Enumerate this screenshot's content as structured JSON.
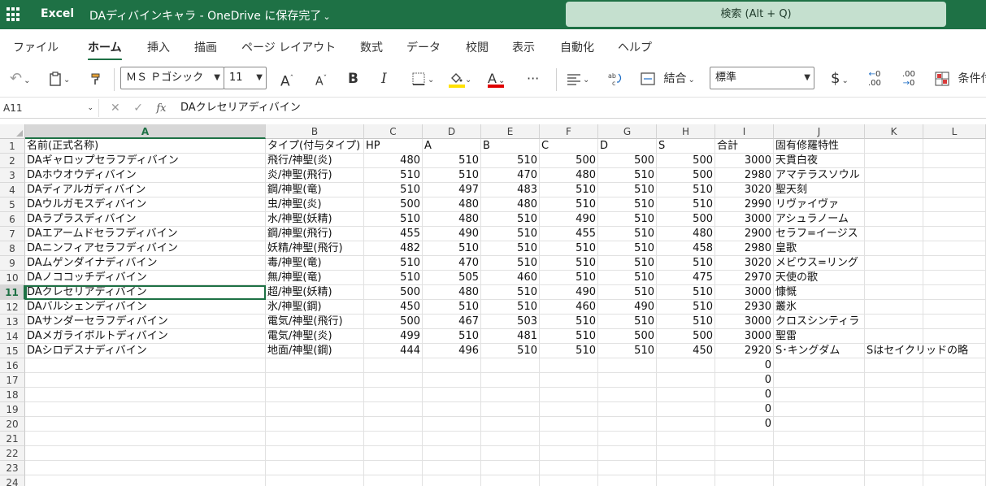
{
  "app": {
    "name": "Excel",
    "doc_title": "DAディバインキャラ - OneDrive に保存完了",
    "search_placeholder": "検索 (Alt + Q)"
  },
  "menu": {
    "tabs": [
      "ファイル",
      "ホーム",
      "挿入",
      "描画",
      "ページ レイアウト",
      "数式",
      "データ",
      "校閲",
      "表示",
      "自動化",
      "ヘルプ"
    ],
    "active": "ホーム"
  },
  "ribbon": {
    "font_name": "ＭＳ Ｐゴシック",
    "font_size": "11",
    "merge_label": "結合",
    "number_format": "標準",
    "currency_symbol": "$",
    "conditional_label": "条件付",
    "bold_glyph": "B",
    "italic_glyph": "I",
    "font_color_glyph": "A",
    "grow_font_glyph": "A",
    "shrink_font_glyph": "A",
    "more_glyph": "···",
    "underline_color": "#ffe100",
    "font_color": "#e00000",
    "inc_decimal_label": ".00",
    "dec_decimal_label": ".00"
  },
  "formula_bar": {
    "name_box": "A11",
    "fx_label": "fx",
    "content": "DAクレセリアディバイン"
  },
  "sheet": {
    "columns": [
      "A",
      "B",
      "C",
      "D",
      "E",
      "F",
      "G",
      "H",
      "I",
      "J",
      "K",
      "L"
    ],
    "row_numbers": [
      "1",
      "2",
      "3",
      "4",
      "5",
      "6",
      "7",
      "8",
      "9",
      "10",
      "11",
      "12",
      "13",
      "14",
      "15",
      "16",
      "17",
      "18",
      "19",
      "20",
      "21",
      "22",
      "23",
      "24"
    ],
    "selected_cell": "A11",
    "rows": [
      [
        "名前(正式名称)",
        "タイプ(付与タイプ)",
        "HP",
        "A",
        "B",
        "C",
        "D",
        "S",
        "合計",
        "固有修羅特性",
        "",
        ""
      ],
      [
        "DAギャロップセラフディバイン",
        "飛行/神聖(炎)",
        "480",
        "510",
        "510",
        "500",
        "500",
        "500",
        "3000",
        "天貫白夜",
        "",
        ""
      ],
      [
        "DAホウオウディバイン",
        "炎/神聖(飛行)",
        "510",
        "510",
        "470",
        "480",
        "510",
        "500",
        "2980",
        "アマテラスソウル",
        "",
        ""
      ],
      [
        "DAディアルガディバイン",
        "鋼/神聖(竜)",
        "510",
        "497",
        "483",
        "510",
        "510",
        "510",
        "3020",
        "聖天刻",
        "",
        ""
      ],
      [
        "DAウルガモスディバイン",
        "虫/神聖(炎)",
        "500",
        "480",
        "480",
        "510",
        "510",
        "510",
        "2990",
        "リヴァイヴァ",
        "",
        ""
      ],
      [
        "DAラプラスディバイン",
        "水/神聖(妖精)",
        "510",
        "480",
        "510",
        "490",
        "510",
        "500",
        "3000",
        "アシュラノーム",
        "",
        ""
      ],
      [
        "DAエアームドセラフディバイン",
        "鋼/神聖(飛行)",
        "455",
        "490",
        "510",
        "455",
        "510",
        "480",
        "2900",
        "セラフ=イージス",
        "",
        ""
      ],
      [
        "DAニンフィアセラフディバイン",
        "妖精/神聖(飛行)",
        "482",
        "510",
        "510",
        "510",
        "510",
        "458",
        "2980",
        "皇歌",
        "",
        ""
      ],
      [
        "DAムゲンダイナディバイン",
        "毒/神聖(竜)",
        "510",
        "470",
        "510",
        "510",
        "510",
        "510",
        "3020",
        "メビウス=リング",
        "",
        ""
      ],
      [
        "DAノココッチディバイン",
        "無/神聖(竜)",
        "510",
        "505",
        "460",
        "510",
        "510",
        "475",
        "2970",
        "天使の歌",
        "",
        ""
      ],
      [
        "DAクレセリアディバイン",
        "超/神聖(妖精)",
        "500",
        "480",
        "510",
        "490",
        "510",
        "510",
        "3000",
        "慷慨",
        "",
        ""
      ],
      [
        "DAバルシェンディバイン",
        "氷/神聖(鋼)",
        "450",
        "510",
        "510",
        "460",
        "490",
        "510",
        "2930",
        "叢氷",
        "",
        ""
      ],
      [
        "DAサンダーセラフディバイン",
        "電気/神聖(飛行)",
        "500",
        "467",
        "503",
        "510",
        "510",
        "510",
        "3000",
        "クロスシンティラ",
        "",
        ""
      ],
      [
        "DAメガライボルトディバイン",
        "電気/神聖(炎)",
        "499",
        "510",
        "481",
        "510",
        "500",
        "500",
        "3000",
        "聖雷",
        "",
        ""
      ],
      [
        "DAシロデスナディバイン",
        "地面/神聖(鋼)",
        "444",
        "496",
        "510",
        "510",
        "510",
        "450",
        "2920",
        "S･キングダム",
        "Sはセイクリッドの略",
        ""
      ],
      [
        "",
        "",
        "",
        "",
        "",
        "",
        "",
        "",
        "0",
        "",
        "",
        ""
      ],
      [
        "",
        "",
        "",
        "",
        "",
        "",
        "",
        "",
        "0",
        "",
        "",
        ""
      ],
      [
        "",
        "",
        "",
        "",
        "",
        "",
        "",
        "",
        "0",
        "",
        "",
        ""
      ],
      [
        "",
        "",
        "",
        "",
        "",
        "",
        "",
        "",
        "0",
        "",
        "",
        ""
      ],
      [
        "",
        "",
        "",
        "",
        "",
        "",
        "",
        "",
        "0",
        "",
        "",
        ""
      ],
      [
        "",
        "",
        "",
        "",
        "",
        "",
        "",
        "",
        "",
        "",
        "",
        ""
      ],
      [
        "",
        "",
        "",
        "",
        "",
        "",
        "",
        "",
        "",
        "",
        "",
        ""
      ],
      [
        "",
        "",
        "",
        "",
        "",
        "",
        "",
        "",
        "",
        "",
        "",
        ""
      ],
      [
        "",
        "",
        "",
        "",
        "",
        "",
        "",
        "",
        "",
        "",
        "",
        ""
      ]
    ]
  }
}
